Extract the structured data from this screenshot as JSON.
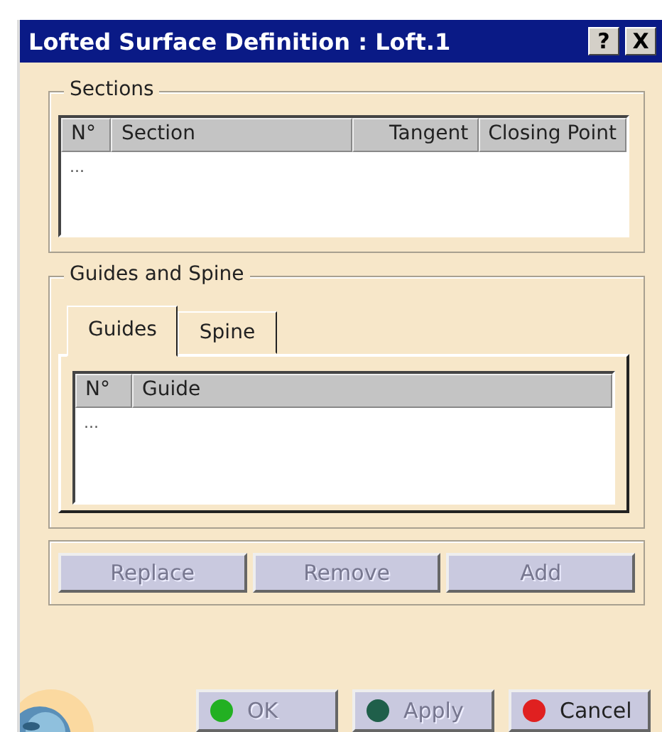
{
  "window": {
    "title": "Lofted Surface Definition : Loft.1",
    "help": "?",
    "close": "X"
  },
  "sections": {
    "title": "Sections",
    "columns": [
      "N°",
      "Section",
      "Tangent",
      "Closing Point"
    ],
    "rows": [
      "..."
    ]
  },
  "guides_and_spine": {
    "title": "Guides and Spine",
    "tabs": [
      {
        "label": "Guides",
        "selected": true
      },
      {
        "label": "Spine",
        "selected": false
      }
    ],
    "columns": [
      "N°",
      "Guide"
    ],
    "rows": [
      "..."
    ]
  },
  "list_buttons": [
    {
      "label": "Replace",
      "disabled": true
    },
    {
      "label": "Remove",
      "disabled": true
    },
    {
      "label": "Add",
      "disabled": true
    }
  ],
  "dialog_buttons": [
    {
      "label": "OK",
      "disabled": true,
      "color": "#22b022"
    },
    {
      "label": "Apply",
      "disabled": true,
      "color": "#1f5f4a"
    },
    {
      "label": "Cancel",
      "disabled": false,
      "color": "#e02020"
    }
  ]
}
